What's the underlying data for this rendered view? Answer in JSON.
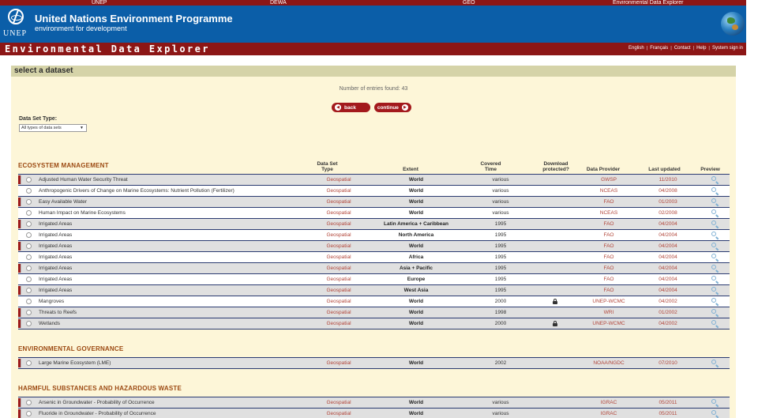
{
  "topbar": {
    "items": [
      "UNEP",
      "DEWA",
      "GEO",
      "Environmental Data Explorer"
    ]
  },
  "header": {
    "logo_text": "UNEP",
    "title": "United Nations Environment Programme",
    "subtitle": "environment for development"
  },
  "titlebar": {
    "app_title": "Environmental Data Explorer",
    "links": [
      "English",
      "Français",
      "Contact",
      "Help",
      "System sign in"
    ]
  },
  "panel": {
    "heading": "select a dataset",
    "entries_text": "Number of entries found: 43",
    "back_label": "back",
    "continue_label": "continue",
    "dataset_type_label": "Data Set Type:",
    "dataset_type_value": "All types of data sets"
  },
  "columns": {
    "type": "Data Set\nType",
    "extent": "Extent",
    "time": "Covered\nTime",
    "download": "Download\nprotected?",
    "provider": "Data Provider",
    "updated": "Last updated",
    "preview": "Preview"
  },
  "sections": [
    {
      "title": "ECOSYSTEM MANAGEMENT",
      "rows": [
        {
          "name": "Adjusted Human Water Security Threat",
          "type": "Geospatial",
          "extent": "World",
          "time": "various",
          "locked": false,
          "provider": "GWSP",
          "updated": "11/2010",
          "marked": true
        },
        {
          "name": "Anthropogenic Drivers of Change on Marine Ecosystems: Nutrient Pollution (Fertilizer)",
          "type": "Geospatial",
          "extent": "World",
          "time": "various",
          "locked": false,
          "provider": "NCEAS",
          "updated": "04/2008",
          "marked": false
        },
        {
          "name": "Easy Available Water",
          "type": "Geospatial",
          "extent": "World",
          "time": "various",
          "locked": false,
          "provider": "FAO",
          "updated": "01/2003",
          "marked": true
        },
        {
          "name": "Human Impact on Marine Ecosystems",
          "type": "Geospatial",
          "extent": "World",
          "time": "various",
          "locked": false,
          "provider": "NCEAS",
          "updated": "02/2008",
          "marked": false
        },
        {
          "name": "Irrigated Areas",
          "type": "Geospatial",
          "extent": "Latin America + Caribbean",
          "time": "1995",
          "locked": false,
          "provider": "FAO",
          "updated": "04/2004",
          "marked": true
        },
        {
          "name": "Irrigated Areas",
          "type": "Geospatial",
          "extent": "North America",
          "time": "1995",
          "locked": false,
          "provider": "FAO",
          "updated": "04/2004",
          "marked": false
        },
        {
          "name": "Irrigated Areas",
          "type": "Geospatial",
          "extent": "World",
          "time": "1995",
          "locked": false,
          "provider": "FAO",
          "updated": "04/2004",
          "marked": true
        },
        {
          "name": "Irrigated Areas",
          "type": "Geospatial",
          "extent": "Africa",
          "time": "1995",
          "locked": false,
          "provider": "FAO",
          "updated": "04/2004",
          "marked": false
        },
        {
          "name": "Irrigated Areas",
          "type": "Geospatial",
          "extent": "Asia + Pacific",
          "time": "1995",
          "locked": false,
          "provider": "FAO",
          "updated": "04/2004",
          "marked": true
        },
        {
          "name": "Irrigated Areas",
          "type": "Geospatial",
          "extent": "Europe",
          "time": "1995",
          "locked": false,
          "provider": "FAO",
          "updated": "04/2004",
          "marked": false
        },
        {
          "name": "Irrigated Areas",
          "type": "Geospatial",
          "extent": "West Asia",
          "time": "1995",
          "locked": false,
          "provider": "FAO",
          "updated": "04/2004",
          "marked": true
        },
        {
          "name": "Mangroves",
          "type": "Geospatial",
          "extent": "World",
          "time": "2000",
          "locked": true,
          "provider": "UNEP-WCMC",
          "updated": "04/2002",
          "marked": false
        },
        {
          "name": "Threats to Reefs",
          "type": "Geospatial",
          "extent": "World",
          "time": "1998",
          "locked": false,
          "provider": "WRI",
          "updated": "01/2002",
          "marked": true
        },
        {
          "name": "Wetlands",
          "type": "Geospatial",
          "extent": "World",
          "time": "2000",
          "locked": true,
          "provider": "UNEP-WCMC",
          "updated": "04/2002",
          "marked": true
        }
      ]
    },
    {
      "title": "ENVIRONMENTAL GOVERNANCE",
      "rows": [
        {
          "name": "Large Marine Ecosystem (LME)",
          "type": "Geospatial",
          "extent": "World",
          "time": "2002",
          "locked": false,
          "provider": "NOAA/NGDC",
          "updated": "07/2010",
          "marked": true
        }
      ]
    },
    {
      "title": "HARMFUL SUBSTANCES AND HAZARDOUS WASTE",
      "rows": [
        {
          "name": "Arsenic in Groundwater - Probability of Occurrence",
          "type": "Geospatial",
          "extent": "World",
          "time": "various",
          "locked": false,
          "provider": "IGRAC",
          "updated": "05/2011",
          "marked": true
        },
        {
          "name": "Fluoride in Groundwater - Probability of Occurrence",
          "type": "Geospatial",
          "extent": "World",
          "time": "various",
          "locked": false,
          "provider": "IGRAC",
          "updated": "05/2011",
          "marked": true
        }
      ]
    }
  ]
}
